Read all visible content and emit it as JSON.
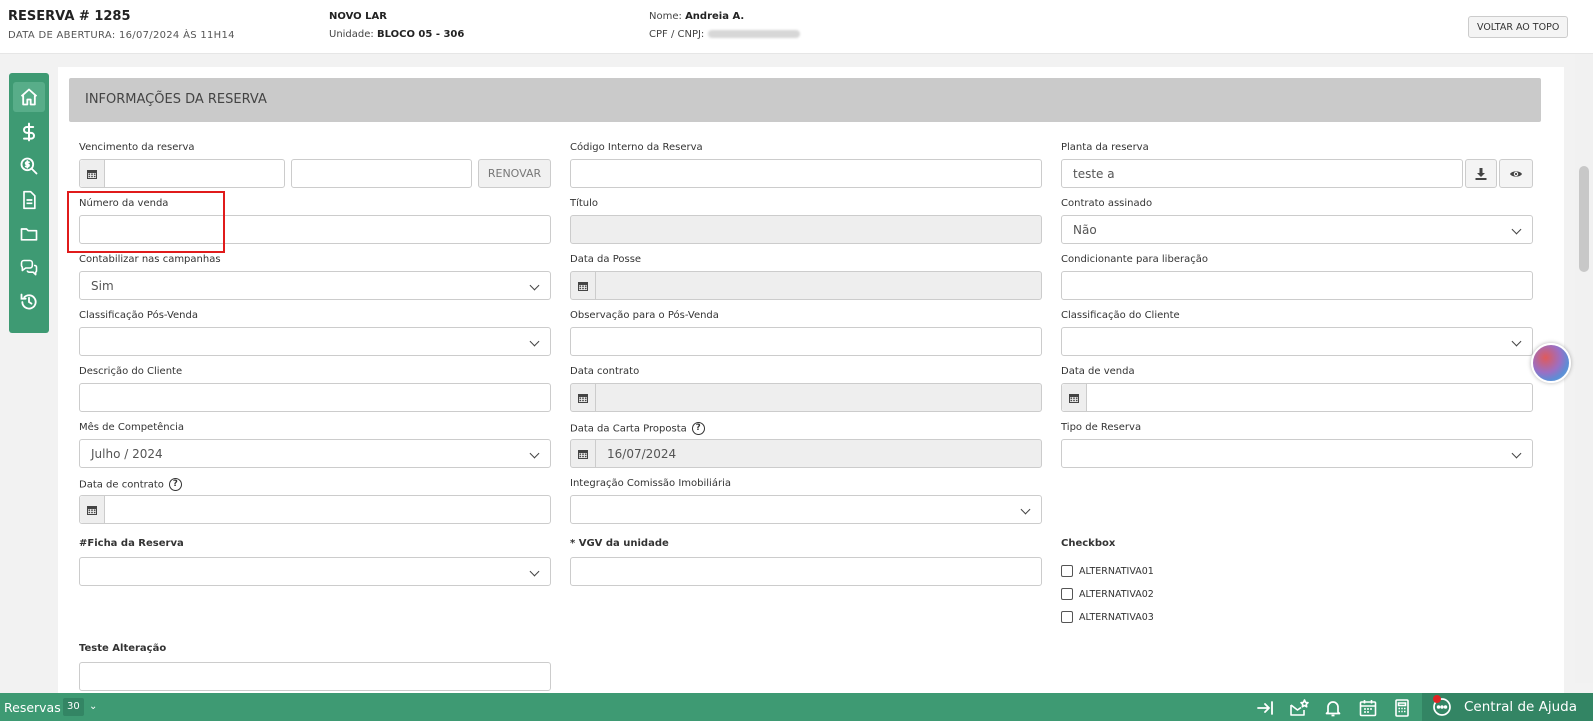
{
  "header": {
    "reservation_title": "RESERVA # 1285",
    "opening_date": "DATA DE ABERTURA: 16/07/2024 ÀS 11H14",
    "project": "NOVO LAR",
    "unit_label": "Unidade:",
    "unit_value": "BLOCO 05 - 306",
    "name_label": "Nome:",
    "name_value": "Andreia A.",
    "cpf_label": "CPF / CNPJ:",
    "back_to_top": "VOLTAR AO TOPO"
  },
  "section": {
    "title": "INFORMAÇÕES DA RESERVA"
  },
  "fields": {
    "vencimento": {
      "label": "Vencimento da reserva",
      "renew": "RENOVAR"
    },
    "codigo_interno": {
      "label": "Código Interno da Reserva",
      "value": ""
    },
    "planta": {
      "label": "Planta da reserva",
      "value": "teste a"
    },
    "numero_venda": {
      "label": "Número da venda",
      "value": ""
    },
    "titulo": {
      "label": "Título",
      "value": ""
    },
    "contrato_assinado": {
      "label": "Contrato assinado",
      "value": "Não"
    },
    "contabilizar": {
      "label": "Contabilizar nas campanhas",
      "value": "Sim"
    },
    "data_posse": {
      "label": "Data da Posse",
      "value": ""
    },
    "condicionante": {
      "label": "Condicionante para liberação",
      "value": ""
    },
    "classificacao_pos": {
      "label": "Classificação Pós-Venda",
      "value": ""
    },
    "observacao_pos": {
      "label": "Observação para o Pós-Venda",
      "value": ""
    },
    "classificacao_cliente": {
      "label": "Classificação do Cliente",
      "value": ""
    },
    "descricao_cliente": {
      "label": "Descrição do Cliente",
      "value": ""
    },
    "data_contrato_top": {
      "label": "Data contrato",
      "value": ""
    },
    "data_venda": {
      "label": "Data de venda",
      "value": ""
    },
    "mes_competencia": {
      "label": "Mês de Competência",
      "value": "Julho / 2024"
    },
    "data_carta": {
      "label": "Data da Carta Proposta",
      "value": "16/07/2024"
    },
    "tipo_reserva": {
      "label": "Tipo de Reserva",
      "value": ""
    },
    "data_de_contrato": {
      "label": "Data de contrato",
      "value": ""
    },
    "integracao": {
      "label": "Integração Comissão Imobiliária",
      "value": ""
    },
    "ficha": {
      "label": "#Ficha da Reserva",
      "value": ""
    },
    "vgv": {
      "label": "* VGV da unidade",
      "value": ""
    },
    "checkbox": {
      "label": "Checkbox",
      "options": [
        "ALTERNATIVA01",
        "ALTERNATIVA02",
        "ALTERNATIVA03"
      ]
    },
    "teste_alteracao": {
      "label": "Teste Alteração",
      "value": ""
    }
  },
  "help_glyph": "?",
  "bottombar": {
    "reservas_label": "Reservas",
    "reservas_count": "30",
    "chevron": "⌄",
    "help_center": "Central de Ajuda"
  },
  "colors": {
    "brand_green": "#3e9a73",
    "highlight_red": "#e01b1b",
    "section_gray": "#cacaca"
  }
}
